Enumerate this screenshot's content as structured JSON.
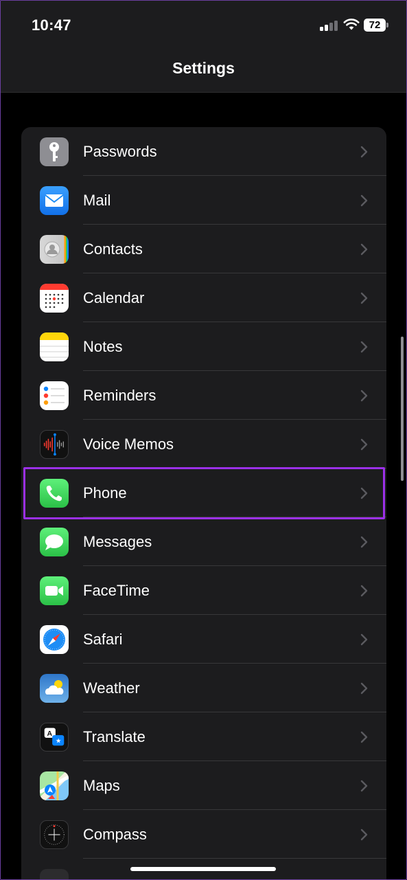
{
  "status_bar": {
    "time": "10:47",
    "battery": "72"
  },
  "header": {
    "title": "Settings"
  },
  "items": [
    {
      "label": "Passwords",
      "icon": "key-icon",
      "color": "#8e8e93"
    },
    {
      "label": "Mail",
      "icon": "mail-icon",
      "color": "#1e8df5"
    },
    {
      "label": "Contacts",
      "icon": "contacts-icon",
      "color": "#c7c7c7"
    },
    {
      "label": "Calendar",
      "icon": "calendar-icon",
      "color": "#ffffff"
    },
    {
      "label": "Notes",
      "icon": "notes-icon",
      "color": "#ffd60a"
    },
    {
      "label": "Reminders",
      "icon": "reminders-icon",
      "color": "#ffffff"
    },
    {
      "label": "Voice Memos",
      "icon": "voice-memos-icon",
      "color": "#1c1c1e"
    },
    {
      "label": "Phone",
      "icon": "phone-icon",
      "color": "#34c759"
    },
    {
      "label": "Messages",
      "icon": "messages-icon",
      "color": "#34c759"
    },
    {
      "label": "FaceTime",
      "icon": "facetime-icon",
      "color": "#34c759"
    },
    {
      "label": "Safari",
      "icon": "safari-icon",
      "color": "#ffffff"
    },
    {
      "label": "Weather",
      "icon": "weather-icon",
      "color": "#3a86d8"
    },
    {
      "label": "Translate",
      "icon": "translate-icon",
      "color": "#1c1c1e"
    },
    {
      "label": "Maps",
      "icon": "maps-icon",
      "color": "#8fd694"
    },
    {
      "label": "Compass",
      "icon": "compass-icon",
      "color": "#1c1c1e"
    }
  ],
  "highlight_color": "#9b30e8"
}
